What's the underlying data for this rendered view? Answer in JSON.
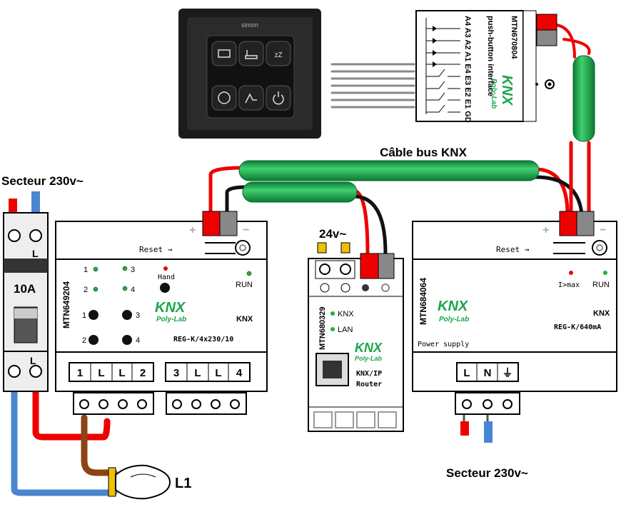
{
  "labels": {
    "cable": "Câble bus KNX",
    "mains_left": "Secteur 230v~",
    "mains_right": "Secteur 230v~",
    "v24": "24v~",
    "lamp": "L1",
    "breaker_rating": "10A",
    "breaker_L_top": "L",
    "breaker_L_bottom": "L"
  },
  "pbi": {
    "model": "MTN670804",
    "name": "push-button interface",
    "pins": "A4 A3 A2 A1 E4 E3 E2 E1 GD",
    "logo": "KNX",
    "logo_sub": "Poly-Lab"
  },
  "panel": {
    "brand": "simon"
  },
  "actuator": {
    "model": "MTN649204",
    "reset": "Reset →",
    "plus": "+",
    "minus": "−",
    "hand": "Hand",
    "run": "RUN",
    "knx": "KNX",
    "type": "REG-K/4x230/10",
    "logo": "KNX",
    "logo_sub": "Poly-Lab",
    "leds": [
      "1",
      "2",
      "3",
      "4"
    ],
    "buttons": [
      "1",
      "2",
      "3",
      "4"
    ],
    "terminals": [
      "1",
      "L",
      "L",
      "2",
      "3",
      "L",
      "L",
      "4"
    ]
  },
  "router": {
    "model": "MTN680329",
    "led1": "KNX",
    "led2": "LAN",
    "logo": "KNX",
    "logo_sub": "Poly-Lab",
    "name1": "KNX/IP",
    "name2": "Router"
  },
  "psu": {
    "model": "MTN684064",
    "reset": "Reset →",
    "plus": "+",
    "minus": "−",
    "imax": "I>max",
    "run": "RUN",
    "knx": "KNX",
    "type": "REG-K/640mA",
    "desc": "Power supply",
    "logo": "KNX",
    "logo_sub": "Poly-Lab",
    "terminals": [
      "L",
      "N",
      "⏚"
    ]
  },
  "colors": {
    "bus_green": "#1aa64a",
    "red": "#ff0000",
    "blue": "#4a86d0",
    "brown": "#8b4513",
    "led_green": "#20b040",
    "led_red": "#e00000"
  }
}
